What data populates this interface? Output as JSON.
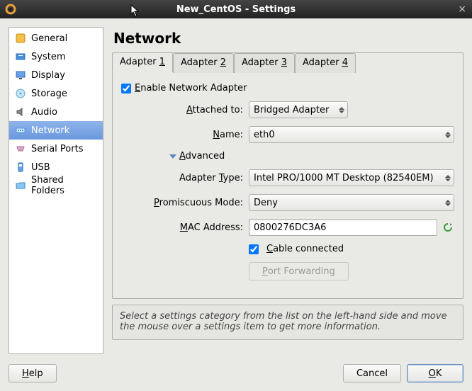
{
  "window": {
    "title": "New_CentOS - Settings",
    "close_glyph": "×"
  },
  "sidebar": {
    "items": [
      {
        "label": "General"
      },
      {
        "label": "System"
      },
      {
        "label": "Display"
      },
      {
        "label": "Storage"
      },
      {
        "label": "Audio"
      },
      {
        "label": "Network"
      },
      {
        "label": "Serial Ports"
      },
      {
        "label": "USB"
      },
      {
        "label": "Shared Folders"
      }
    ],
    "selected_index": 5
  },
  "page": {
    "title": "Network",
    "tabs": [
      {
        "prefix": "Adapter ",
        "hotkey": "1"
      },
      {
        "prefix": "Adapter ",
        "hotkey": "2"
      },
      {
        "prefix": "Adapter ",
        "hotkey": "3"
      },
      {
        "prefix": "Adapter ",
        "hotkey": "4"
      }
    ],
    "active_tab": 0,
    "enable_label_suffix": "nable Network Adapter",
    "enable_hotkey": "E",
    "enable_checked": true,
    "attached_label_suffix": "ttached to:",
    "attached_hotkey": "A",
    "attached_value": "Bridged Adapter",
    "name_label_prefix": "",
    "name_hotkey": "N",
    "name_label_suffix": "ame:",
    "name_value": "eth0",
    "advanced_hotkey": "A",
    "advanced_suffix": "dvanced",
    "type_label_prefix": "Adapter ",
    "type_hotkey": "T",
    "type_label_suffix": "ype:",
    "type_value": "Intel PRO/1000 MT Desktop (82540EM)",
    "promisc_hotkey": "P",
    "promisc_label_suffix": "romiscuous Mode:",
    "promisc_value": "Deny",
    "mac_label_prefix": "",
    "mac_hotkey": "M",
    "mac_label_suffix": "AC Address:",
    "mac_value": "0800276DC3A6",
    "cable_hotkey": "C",
    "cable_label_suffix": "able connected",
    "cable_checked": true,
    "portfwd_prefix": "",
    "portfwd_hotkey": "P",
    "portfwd_suffix": "ort Forwarding"
  },
  "hint": "Select a settings category from the list on the left-hand side and move the mouse over a settings item to get more information.",
  "footer": {
    "help_hotkey": "H",
    "help_suffix": "elp",
    "cancel": "Cancel",
    "ok_hotkey": "O",
    "ok_suffix": "K"
  }
}
